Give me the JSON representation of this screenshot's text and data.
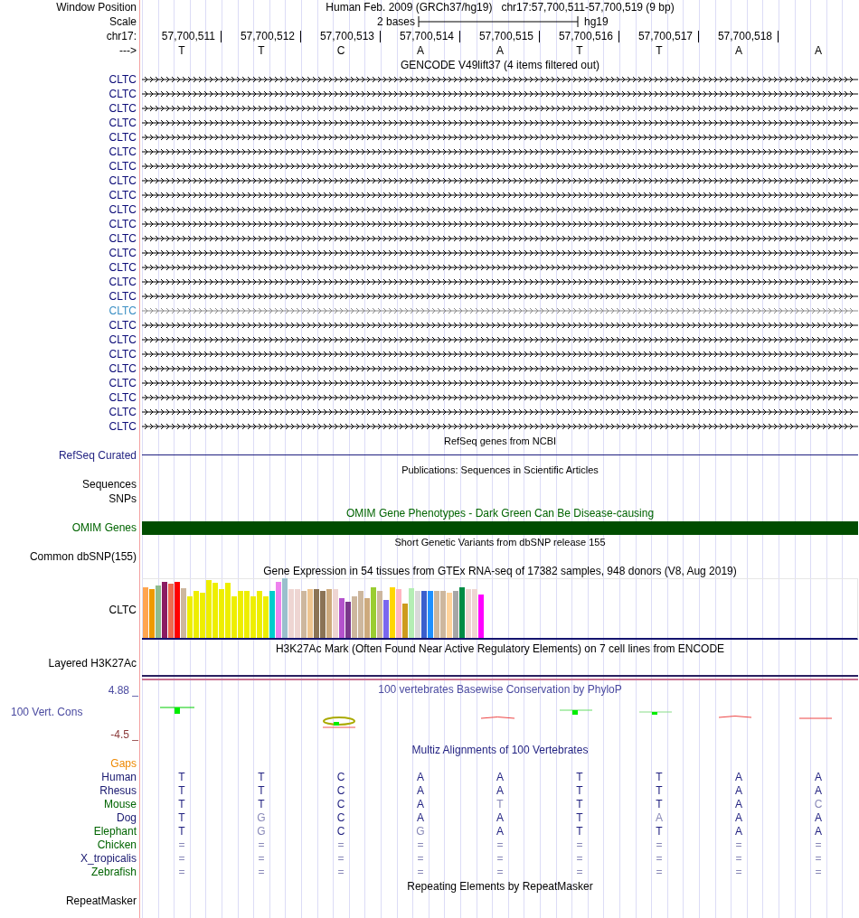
{
  "header": {
    "label": "Window Position",
    "assembly": "Human Feb. 2009 (GRCh37/hg19)",
    "position": "chr17:57,700,511-57,700,519 (9 bp)"
  },
  "scale": {
    "label": "Scale",
    "length": "2 bases",
    "assembly": "hg19"
  },
  "ruler": {
    "label": "chr17:",
    "ticks": [
      "57,700,511",
      "57,700,512",
      "57,700,513",
      "57,700,514",
      "57,700,515",
      "57,700,516",
      "57,700,517",
      "57,700,518"
    ]
  },
  "strand": {
    "label": "--->",
    "bases": [
      "T",
      "T",
      "C",
      "A",
      "A",
      "T",
      "T",
      "A",
      "A"
    ]
  },
  "gencode": {
    "title": "GENCODE V49lift37 (4 items filtered out)",
    "items": [
      {
        "name": "CLTC",
        "selected": false
      },
      {
        "name": "CLTC",
        "selected": false
      },
      {
        "name": "CLTC",
        "selected": false
      },
      {
        "name": "CLTC",
        "selected": false
      },
      {
        "name": "CLTC",
        "selected": false
      },
      {
        "name": "CLTC",
        "selected": false
      },
      {
        "name": "CLTC",
        "selected": false
      },
      {
        "name": "CLTC",
        "selected": false
      },
      {
        "name": "CLTC",
        "selected": false
      },
      {
        "name": "CLTC",
        "selected": false
      },
      {
        "name": "CLTC",
        "selected": false
      },
      {
        "name": "CLTC",
        "selected": false
      },
      {
        "name": "CLTC",
        "selected": false
      },
      {
        "name": "CLTC",
        "selected": false
      },
      {
        "name": "CLTC",
        "selected": false
      },
      {
        "name": "CLTC",
        "selected": false
      },
      {
        "name": "CLTC",
        "selected": true
      },
      {
        "name": "CLTC",
        "selected": false
      },
      {
        "name": "CLTC",
        "selected": false
      },
      {
        "name": "CLTC",
        "selected": false
      },
      {
        "name": "CLTC",
        "selected": false
      },
      {
        "name": "CLTC",
        "selected": false
      },
      {
        "name": "CLTC",
        "selected": false
      },
      {
        "name": "CLTC",
        "selected": false
      },
      {
        "name": "CLTC",
        "selected": false
      }
    ]
  },
  "refseq": {
    "title": "RefSeq genes from NCBI",
    "label": "RefSeq Curated"
  },
  "publications": {
    "title": "Publications: Sequences in Scientific Articles",
    "labels": [
      "Sequences",
      "SNPs"
    ]
  },
  "omim": {
    "title": "OMIM Gene Phenotypes - Dark Green Can Be Disease-causing",
    "label": "OMIM Genes"
  },
  "dbsnp": {
    "title": "Short Genetic Variants from dbSNP release 155",
    "label": "Common dbSNP(155)"
  },
  "gtex": {
    "title": "Gene Expression in 54 tissues from GTEx RNA-seq of 17382 samples, 948 donors (V8, Aug 2019)",
    "label": "CLTC",
    "bars": [
      {
        "color": "#ffa54f"
      },
      {
        "color": "#ee9a00"
      },
      {
        "color": "#8fbc8f"
      },
      {
        "color": "#8b1c62"
      },
      {
        "color": "#ee6a50"
      },
      {
        "color": "#ff0000"
      },
      {
        "color": "#cdb79e"
      },
      {
        "color": "#eeee00"
      },
      {
        "color": "#eeee00"
      },
      {
        "color": "#eeee00"
      },
      {
        "color": "#eeee00"
      },
      {
        "color": "#eeee00"
      },
      {
        "color": "#eeee00"
      },
      {
        "color": "#eeee00"
      },
      {
        "color": "#eeee00"
      },
      {
        "color": "#eeee00"
      },
      {
        "color": "#eeee00"
      },
      {
        "color": "#eeee00"
      },
      {
        "color": "#eeee00"
      },
      {
        "color": "#eeee00"
      },
      {
        "color": "#00cdcd"
      },
      {
        "color": "#ee82ee"
      },
      {
        "color": "#9ac0cd"
      },
      {
        "color": "#eed5d2"
      },
      {
        "color": "#eed5d2"
      },
      {
        "color": "#cdb79e"
      },
      {
        "color": "#eec591"
      },
      {
        "color": "#8b7355"
      },
      {
        "color": "#8b7355"
      },
      {
        "color": "#cdaa7d"
      },
      {
        "color": "#eed5d2"
      },
      {
        "color": "#b452cd"
      },
      {
        "color": "#7a378b"
      },
      {
        "color": "#cdb79e"
      },
      {
        "color": "#cdb79e"
      },
      {
        "color": "#cdaa7d"
      },
      {
        "color": "#9acd32"
      },
      {
        "color": "#cdb79e"
      },
      {
        "color": "#7a67ee"
      },
      {
        "color": "#ffd700"
      },
      {
        "color": "#ffb6c1"
      },
      {
        "color": "#cd9b1d"
      },
      {
        "color": "#b4eeb4"
      },
      {
        "color": "#d9d9d9"
      },
      {
        "color": "#3a5fcd"
      },
      {
        "color": "#1e90ff"
      },
      {
        "color": "#cdb79e"
      },
      {
        "color": "#cdb79e"
      },
      {
        "color": "#ffd39b"
      },
      {
        "color": "#a6a6a6"
      },
      {
        "color": "#008b45"
      },
      {
        "color": "#eed5d2"
      },
      {
        "color": "#eed5d2"
      },
      {
        "color": "#ff00ff"
      }
    ]
  },
  "h3k27ac": {
    "title": "H3K27Ac Mark (Often Found Near Active Regulatory Elements) on 7 cell lines from ENCODE",
    "label": "Layered H3K27Ac"
  },
  "phylop": {
    "title": "100 vertebrates Basewise Conservation by PhyloP",
    "label": "100 Vert. Cons",
    "ymax": "4.88 _",
    "ymin": "-4.5 _"
  },
  "multiz": {
    "title": "Multiz Alignments of 100 Vertebrates",
    "gaps_label": "Gaps",
    "species": [
      {
        "name": "Human",
        "color": "#191970",
        "bases": [
          {
            "b": "T",
            "faded": false
          },
          {
            "b": "T",
            "faded": false
          },
          {
            "b": "C",
            "faded": false
          },
          {
            "b": "A",
            "faded": false
          },
          {
            "b": "A",
            "faded": false
          },
          {
            "b": "T",
            "faded": false
          },
          {
            "b": "T",
            "faded": false
          },
          {
            "b": "A",
            "faded": false
          },
          {
            "b": "A",
            "faded": false
          }
        ]
      },
      {
        "name": "Rhesus",
        "color": "#191970",
        "bases": [
          {
            "b": "T",
            "faded": false
          },
          {
            "b": "T",
            "faded": false
          },
          {
            "b": "C",
            "faded": false
          },
          {
            "b": "A",
            "faded": false
          },
          {
            "b": "A",
            "faded": false
          },
          {
            "b": "T",
            "faded": false
          },
          {
            "b": "T",
            "faded": false
          },
          {
            "b": "A",
            "faded": false
          },
          {
            "b": "A",
            "faded": false
          }
        ]
      },
      {
        "name": "Mouse",
        "color": "#006400",
        "bases": [
          {
            "b": "T",
            "faded": false
          },
          {
            "b": "T",
            "faded": false
          },
          {
            "b": "C",
            "faded": false
          },
          {
            "b": "A",
            "faded": false
          },
          {
            "b": "T",
            "faded": true
          },
          {
            "b": "T",
            "faded": false
          },
          {
            "b": "T",
            "faded": false
          },
          {
            "b": "A",
            "faded": false
          },
          {
            "b": "C",
            "faded": true
          }
        ]
      },
      {
        "name": "Dog",
        "color": "#191970",
        "bases": [
          {
            "b": "T",
            "faded": false
          },
          {
            "b": "G",
            "faded": true
          },
          {
            "b": "C",
            "faded": false
          },
          {
            "b": "A",
            "faded": false
          },
          {
            "b": "A",
            "faded": false
          },
          {
            "b": "T",
            "faded": false
          },
          {
            "b": "A",
            "faded": true
          },
          {
            "b": "A",
            "faded": false
          },
          {
            "b": "A",
            "faded": false
          }
        ]
      },
      {
        "name": "Elephant",
        "color": "#006400",
        "bases": [
          {
            "b": "T",
            "faded": false
          },
          {
            "b": "G",
            "faded": true
          },
          {
            "b": "C",
            "faded": false
          },
          {
            "b": "G",
            "faded": true
          },
          {
            "b": "A",
            "faded": false
          },
          {
            "b": "T",
            "faded": false
          },
          {
            "b": "T",
            "faded": false
          },
          {
            "b": "A",
            "faded": false
          },
          {
            "b": "A",
            "faded": false
          }
        ]
      },
      {
        "name": "Chicken",
        "color": "#006400",
        "bases": [
          {
            "b": "=",
            "faded": true
          },
          {
            "b": "=",
            "faded": true
          },
          {
            "b": "=",
            "faded": true
          },
          {
            "b": "=",
            "faded": true
          },
          {
            "b": "=",
            "faded": true
          },
          {
            "b": "=",
            "faded": true
          },
          {
            "b": "=",
            "faded": true
          },
          {
            "b": "=",
            "faded": true
          },
          {
            "b": "=",
            "faded": true
          }
        ]
      },
      {
        "name": "X_tropicalis",
        "color": "#191970",
        "bases": [
          {
            "b": "=",
            "faded": true
          },
          {
            "b": "=",
            "faded": true
          },
          {
            "b": "=",
            "faded": true
          },
          {
            "b": "=",
            "faded": true
          },
          {
            "b": "=",
            "faded": true
          },
          {
            "b": "=",
            "faded": true
          },
          {
            "b": "=",
            "faded": true
          },
          {
            "b": "=",
            "faded": true
          },
          {
            "b": "=",
            "faded": true
          }
        ]
      },
      {
        "name": "Zebrafish",
        "color": "#006400",
        "bases": [
          {
            "b": "=",
            "faded": true
          },
          {
            "b": "=",
            "faded": true
          },
          {
            "b": "=",
            "faded": true
          },
          {
            "b": "=",
            "faded": true
          },
          {
            "b": "=",
            "faded": true
          },
          {
            "b": "=",
            "faded": true
          },
          {
            "b": "=",
            "faded": true
          },
          {
            "b": "=",
            "faded": true
          },
          {
            "b": "=",
            "faded": true
          }
        ]
      }
    ]
  },
  "repeatmasker": {
    "title": "Repeating Elements by RepeatMasker",
    "label": "RepeatMasker"
  }
}
